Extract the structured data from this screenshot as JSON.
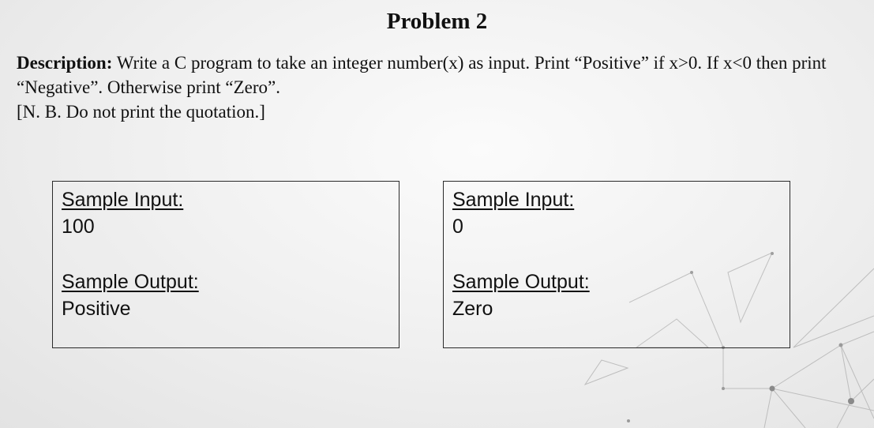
{
  "slide": {
    "title": "Problem 2",
    "description": {
      "label": "Description:",
      "text": " Write a C program to take an integer number(x) as input. Print “Positive” if x>0. If x<0 then print “Negative”. Otherwise print “Zero”.",
      "note": "[N. B. Do not print the quotation.]"
    },
    "samples": [
      {
        "input_label": "Sample Input:",
        "input_value": "100",
        "output_label": "Sample Output:",
        "output_value": "Positive"
      },
      {
        "input_label": "Sample Input:",
        "input_value": "0",
        "output_label": "Sample Output:",
        "output_value": "Zero"
      }
    ]
  }
}
